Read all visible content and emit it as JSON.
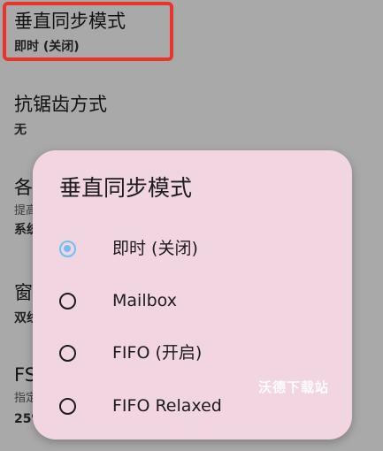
{
  "settings": {
    "vsync": {
      "title": "垂直同步模式",
      "value": "即时 (关闭)"
    },
    "antialiasing": {
      "title": "抗锯齿方式",
      "value": "无"
    },
    "item3": {
      "title": "各",
      "desc": "提高",
      "value": "系统"
    },
    "item4": {
      "title": "窗",
      "value": "双线"
    },
    "item5": {
      "title": "FS",
      "desc": "指定",
      "value": "25%"
    }
  },
  "dialog": {
    "title": "垂直同步模式",
    "options": [
      {
        "label": "即时 (关闭)",
        "selected": true
      },
      {
        "label": "Mailbox",
        "selected": false
      },
      {
        "label": "FIFO (开启)",
        "selected": false
      },
      {
        "label": "FIFO Relaxed",
        "selected": false
      }
    ]
  },
  "watermark": "沃德下载站",
  "colors": {
    "scrim": "#a9a9a9",
    "dialog_bg": "#f1d6e2",
    "radio_selected": "#6fc0ef",
    "highlight": "#e8352b"
  }
}
